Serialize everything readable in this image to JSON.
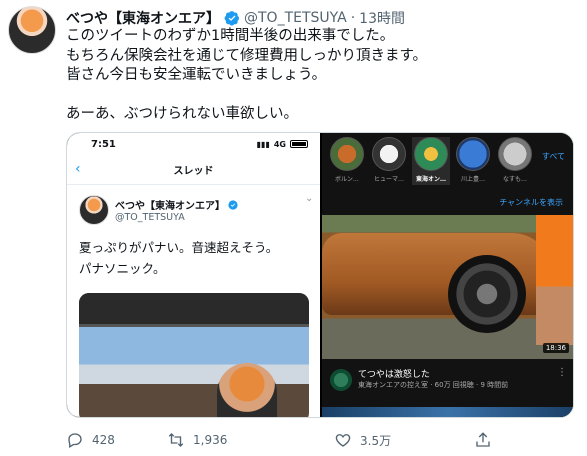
{
  "tweet": {
    "author_name": "べつや【東海オンエア】",
    "handle": "@TO_TETSUYA",
    "separator": "·",
    "time": "13時間",
    "text": "このツイートのわずか1時間半後の出来事でした。\nもちろん保険会社を通じて修理費用しっかり頂きます。\n皆さん今日も安全運転でいきましょう。\n\nあーあ、ぶつけられない車欲しい。",
    "accent_color": "#1d9bf0"
  },
  "phone": {
    "time": "7:51",
    "network": "4G",
    "nav_title": "スレッド",
    "author_name": "べつや【東海オンエア】",
    "handle": "@TO_TETSUYA",
    "text": "夏っぷりがパナい。音速超えそう。\nパナソニック。"
  },
  "youtube": {
    "channels": [
      "ボルン…",
      "ヒューマ…",
      "東海オン…",
      "川上豊…",
      "なすも…"
    ],
    "active_channel_index": 2,
    "all_label": "すべて",
    "channel_link": "チャンネルを表示",
    "duration": "18:36",
    "video_title": "てつやは激怒した",
    "video_meta": "東海オンエアの控え室 · 60万 回視聴 · 9 時間前"
  },
  "actions": {
    "replies": "428",
    "retweets": "1,936",
    "likes": "3.5万"
  }
}
